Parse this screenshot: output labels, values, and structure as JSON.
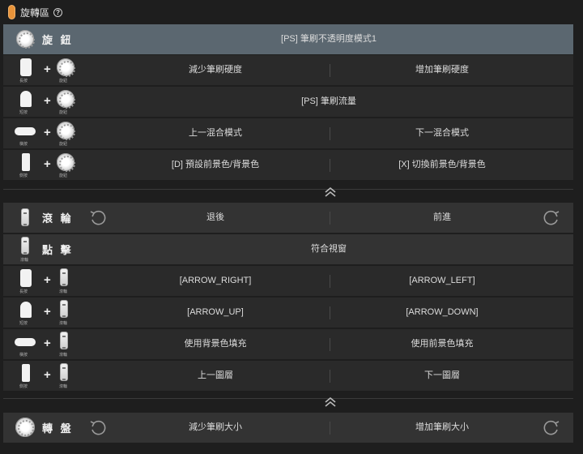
{
  "header": {
    "title": "旋轉區",
    "help_icon": "?"
  },
  "knob": {
    "label": "旋 鈕",
    "main_function": "[PS] 筆刷不透明度模式1",
    "rows": [
      {
        "key_label": "長按",
        "left": "減少筆刷硬度",
        "right": "增加筆刷硬度"
      },
      {
        "key_label": "短按",
        "center": "[PS] 筆刷流量"
      },
      {
        "key_label": "橫按",
        "left": "上一混合模式",
        "right": "下一混合模式"
      },
      {
        "key_label": "側按",
        "left": "[D] 預設前景色/背景色",
        "right": "[X] 切換前景色/背景色"
      }
    ],
    "dial_label": "旋鈕"
  },
  "wheel": {
    "label": "滾 輪",
    "left": "退後",
    "right": "前進",
    "click_label": "點 擊",
    "click_function": "符合視窗",
    "rows": [
      {
        "key_label": "長按",
        "left": "[ARROW_RIGHT]",
        "right": "[ARROW_LEFT]"
      },
      {
        "key_label": "短按",
        "left": "[ARROW_UP]",
        "right": "[ARROW_DOWN]"
      },
      {
        "key_label": "橫按",
        "left": "使用背景色填充",
        "right": "使用前景色填充"
      },
      {
        "key_label": "側按",
        "left": "上一圖層",
        "right": "下一圖層"
      }
    ],
    "wheel_label": "滾輪"
  },
  "dial": {
    "label": "轉 盤",
    "left": "減少筆刷大小",
    "right": "增加筆刷大小"
  },
  "colors": {
    "accent": "#e8933a",
    "highlight_row": "#5b6770",
    "background": "#1e1e1e"
  },
  "icons": [
    "pill-icon",
    "help-icon",
    "knob-icon",
    "wheel-icon",
    "rotate-left-icon",
    "rotate-right-icon",
    "collapse-chevron-icon",
    "turntable-icon"
  ]
}
